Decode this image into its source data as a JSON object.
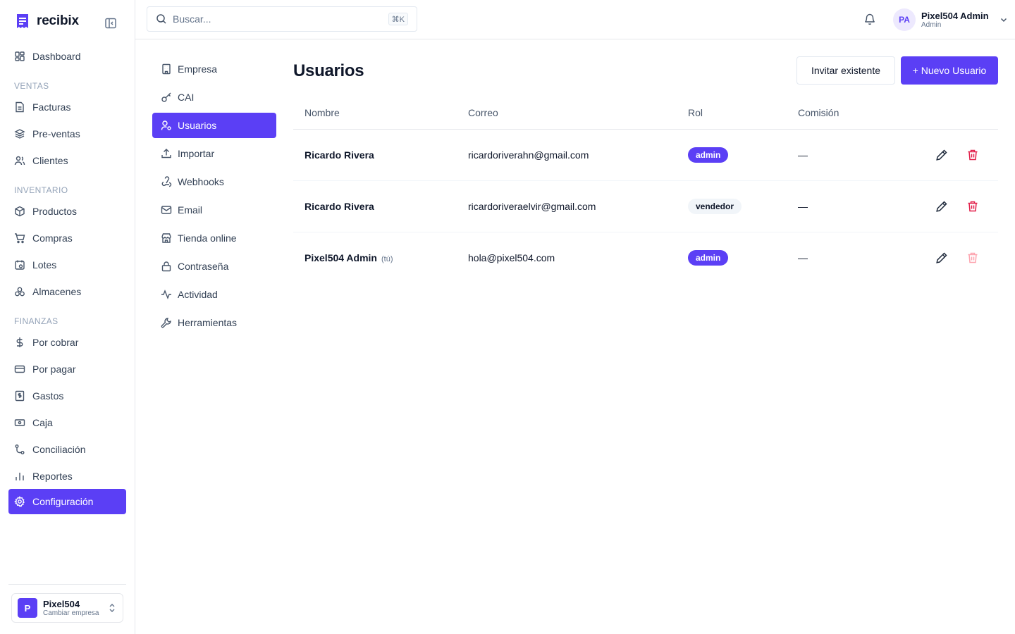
{
  "brand": {
    "name": "recibix",
    "color": "#5b3ff5"
  },
  "sidebar": {
    "items": [
      {
        "label": "Dashboard",
        "icon": "dashboard-icon"
      },
      {
        "label": "Facturas",
        "icon": "invoice-icon"
      },
      {
        "label": "Pre-ventas",
        "icon": "layers-icon"
      },
      {
        "label": "Clientes",
        "icon": "users-icon"
      },
      {
        "label": "Productos",
        "icon": "package-icon"
      },
      {
        "label": "Compras",
        "icon": "cart-icon"
      },
      {
        "label": "Lotes",
        "icon": "calendar-icon"
      },
      {
        "label": "Almacenes",
        "icon": "boxes-icon"
      },
      {
        "label": "Por cobrar",
        "icon": "dollar-icon"
      },
      {
        "label": "Por pagar",
        "icon": "credit-card-icon"
      },
      {
        "label": "Gastos",
        "icon": "receipt-icon"
      },
      {
        "label": "Caja",
        "icon": "banknote-icon"
      },
      {
        "label": "Conciliación",
        "icon": "git-branch-icon"
      },
      {
        "label": "Reportes",
        "icon": "bar-chart-icon"
      },
      {
        "label": "Configuración",
        "icon": "gear-icon",
        "active": true
      }
    ],
    "sections": [
      "VENTAS",
      "INVENTARIO",
      "FINANZAS"
    ],
    "company": {
      "initial": "P",
      "name": "Pixel504",
      "subtitle": "Cambiar empresa"
    }
  },
  "topbar": {
    "search_placeholder": "Buscar...",
    "search_shortcut": "⌘K",
    "user": {
      "initials": "PA",
      "name": "Pixel504 Admin",
      "role": "Admin"
    }
  },
  "settings_nav": [
    {
      "label": "Empresa",
      "icon": "building-icon"
    },
    {
      "label": "CAI",
      "icon": "key-icon"
    },
    {
      "label": "Usuarios",
      "icon": "user-settings-icon",
      "active": true
    },
    {
      "label": "Importar",
      "icon": "upload-icon"
    },
    {
      "label": "Webhooks",
      "icon": "webhook-icon"
    },
    {
      "label": "Email",
      "icon": "mail-icon"
    },
    {
      "label": "Tienda online",
      "icon": "store-icon"
    },
    {
      "label": "Contraseña",
      "icon": "lock-icon"
    },
    {
      "label": "Actividad",
      "icon": "activity-icon"
    },
    {
      "label": "Herramientas",
      "icon": "wrench-icon"
    }
  ],
  "main": {
    "title": "Usuarios",
    "invite_label": "Invitar existente",
    "new_user_label": "+ Nuevo Usuario",
    "columns": [
      "Nombre",
      "Correo",
      "Rol",
      "Comisión"
    ],
    "users": [
      {
        "name": "Ricardo Rivera",
        "you": "",
        "email": "ricardoriverahn@gmail.com",
        "role": "admin",
        "commission": "—",
        "can_delete": true
      },
      {
        "name": "Ricardo Rivera",
        "you": "",
        "email": "ricardoriveraelvir@gmail.com",
        "role": "vendedor",
        "commission": "—",
        "can_delete": true
      },
      {
        "name": "Pixel504 Admin",
        "you": "(tú)",
        "email": "hola@pixel504.com",
        "role": "admin",
        "commission": "—",
        "can_delete": false
      }
    ]
  }
}
